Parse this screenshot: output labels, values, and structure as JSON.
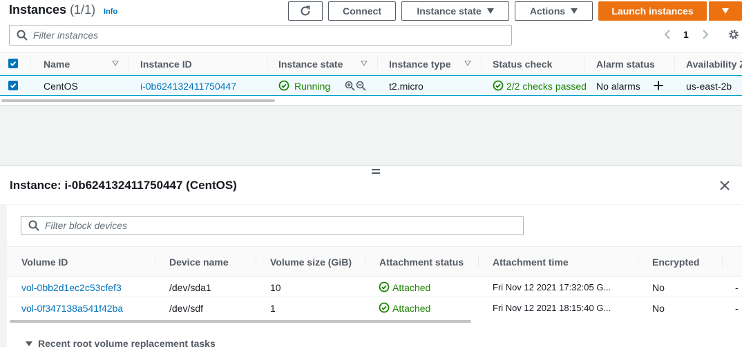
{
  "header": {
    "title": "Instances",
    "count": "(1/1)",
    "info": "Info",
    "buttons": {
      "refresh_icon": "refresh-icon",
      "connect": "Connect",
      "instance_state": "Instance state",
      "actions": "Actions",
      "launch": "Launch instances"
    }
  },
  "filter": {
    "placeholder": "Filter instances"
  },
  "pager": {
    "page": "1"
  },
  "instances_table": {
    "columns": [
      "Name",
      "Instance ID",
      "Instance state",
      "Instance type",
      "Status check",
      "Alarm status",
      "Availability Z"
    ],
    "rows": [
      {
        "name": "CentOS",
        "instance_id": "i-0b624132411750447",
        "state": "Running",
        "type": "t2.micro",
        "status_check": "2/2 checks passed",
        "alarm": "No alarms",
        "az": "us-east-2b"
      }
    ]
  },
  "detail": {
    "title": "Instance: i-0b624132411750447 (CentOS)",
    "block_filter_placeholder": "Filter block devices",
    "columns": [
      "Volume ID",
      "Device name",
      "Volume size (GiB)",
      "Attachment status",
      "Attachment time",
      "Encrypted"
    ],
    "rows": [
      {
        "volume_id": "vol-0bb2d1ec2c53cfef3",
        "device": "/dev/sda1",
        "size": "10",
        "status": "Attached",
        "time": "Fri Nov 12 2021 17:32:05 G...",
        "encrypted": "No",
        "extra": "-"
      },
      {
        "volume_id": "vol-0f347138a541f42ba",
        "device": "/dev/sdf",
        "size": "1",
        "status": "Attached",
        "time": "Fri Nov 12 2021 18:15:40 G...",
        "encrypted": "No",
        "extra": "-"
      }
    ],
    "section_label": "Recent root volume replacement tasks"
  },
  "colors": {
    "accent": "#0073bb",
    "primary_button": "#ec7211",
    "success": "#1d8102"
  }
}
